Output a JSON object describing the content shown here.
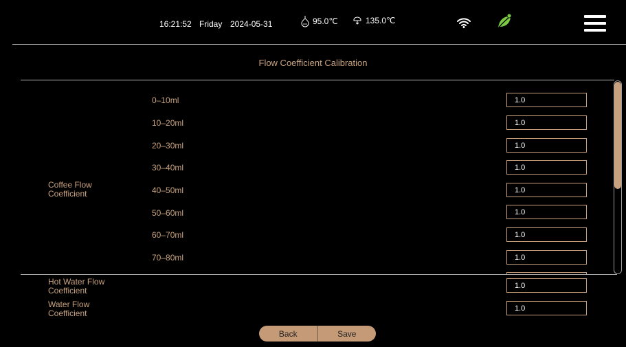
{
  "status": {
    "time": "16:21:52",
    "day": "Friday",
    "date": "2024-05-31",
    "temp_steam": "95.0℃",
    "temp_boiler": "135.0℃",
    "icons": [
      "steam-temp-icon",
      "boiler-temp-icon",
      "wifi-icon",
      "leaf-icon",
      "hamburger-menu-icon"
    ],
    "accent_color": "#c8a27e",
    "leaf_color": "#7ac943"
  },
  "page": {
    "title": "Flow Coefficient Calibration"
  },
  "coffee": {
    "group_label": "Coffee Flow\nCoefficient",
    "rows": [
      {
        "label": "0–10ml",
        "value": "1.0"
      },
      {
        "label": "10–20ml",
        "value": "1.0"
      },
      {
        "label": "20–30ml",
        "value": "1.0"
      },
      {
        "label": "30–40ml",
        "value": "1.0"
      },
      {
        "label": "40–50ml",
        "value": "1.0"
      },
      {
        "label": "50–60ml",
        "value": "1.0"
      },
      {
        "label": "60–70ml",
        "value": "1.0"
      },
      {
        "label": "70–80ml",
        "value": "1.0"
      }
    ]
  },
  "hot_water": {
    "label": "Hot Water Flow\nCoefficient",
    "value": "1.0"
  },
  "water": {
    "label": "Water Flow\nCoefficient",
    "value": "1.0"
  },
  "buttons": {
    "back": "Back",
    "save": "Save"
  }
}
